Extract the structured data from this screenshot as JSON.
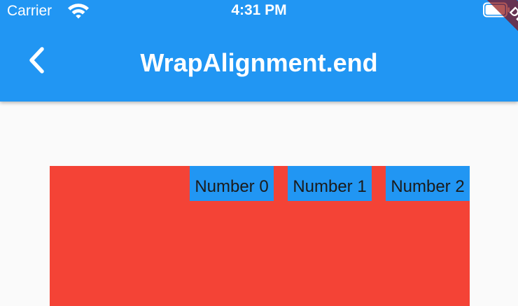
{
  "status_bar": {
    "carrier": "Carrier",
    "time": "4:31 PM"
  },
  "app_bar": {
    "title": "WrapAlignment.end",
    "back_icon": "chevron-left-icon",
    "background_color": "#2196f3"
  },
  "debug_banner": {
    "label": "DEBUG"
  },
  "wrap": {
    "alignment": "end",
    "background_color": "#f44336",
    "item_color": "#2196f3",
    "items": [
      {
        "label": "Number 0"
      },
      {
        "label": "Number 1"
      },
      {
        "label": "Number 2"
      }
    ]
  }
}
